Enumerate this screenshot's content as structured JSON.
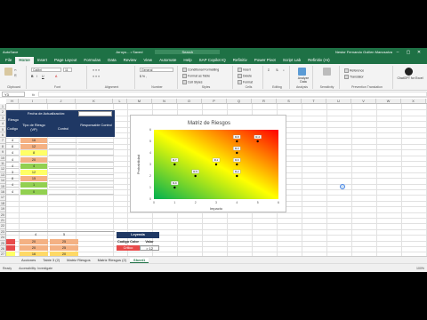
{
  "titlebar": {
    "autosave": "AutoSave",
    "doc": "Arroyo... • Saved",
    "search": "Search",
    "user": "Nestor Fernando Guillen Manosalva"
  },
  "tabs": [
    "File",
    "Home",
    "Insert",
    "Page Layout",
    "Formulas",
    "Data",
    "Review",
    "View",
    "Automate",
    "Help",
    "SAP Copilot IQ",
    "Refinitiv",
    "Power Pivot",
    "Script Lab",
    "Refinitiv (AI)"
  ],
  "ribbon": {
    "font_name": "Calibri",
    "font_size": "11",
    "number_format": "General",
    "groups": [
      "Clipboard",
      "Font",
      "Alignment",
      "Number",
      "Styles",
      "Cells",
      "Editing",
      "Analysis",
      "Sensitivity",
      "Prevention Translation",
      ""
    ],
    "styles": [
      "Conditional Formatting",
      "Format as Table",
      "Cell Styles"
    ],
    "cells": [
      "Insert",
      "Delete",
      "Format"
    ],
    "analyze": "Analyze Data",
    "reference": "Reference",
    "translator": "Translator",
    "gpt": "ChatGPT for Excel"
  },
  "formula_bar": {
    "name_box": "Y3",
    "fx": "fx"
  },
  "columns": [
    "H",
    "I",
    "J",
    "K",
    "L",
    "M",
    "N",
    "O",
    "P",
    "Q",
    "R",
    "S",
    "T",
    "U",
    "V",
    "W",
    "X",
    "Y",
    "Z",
    "AA",
    "AB"
  ],
  "rows": [
    "1",
    "2",
    "3",
    "4",
    "5",
    "6",
    "7",
    "8",
    "9",
    "10",
    "11",
    "12",
    "13",
    "14",
    "15",
    "16",
    "17",
    "18",
    "19",
    "20",
    "21",
    "22",
    "23",
    "24",
    "25",
    "26",
    "27"
  ],
  "sheet": {
    "fecha_label": "Fecha de Actualización:",
    "header": {
      "riesgo": "Riesgo",
      "codigo": "Codigo",
      "tipo": "Tipo de Riesgo (VP)",
      "control": "Control",
      "responsable": "Responsable Control"
    },
    "rows": [
      {
        "code": "4",
        "val": "16",
        "color": "#f4b183"
      },
      {
        "code": "8",
        "val": "12",
        "color": "#f4b183"
      },
      {
        "code": "4",
        "val": "8",
        "color": "#ffff66"
      },
      {
        "code": "4",
        "val": "20",
        "color": "#f4b183"
      },
      {
        "code": "4",
        "val": "4",
        "color": "#92d050"
      },
      {
        "code": "3",
        "val": "12",
        "color": "#ffff66"
      },
      {
        "code": "8",
        "val": "15",
        "color": "#f4b183"
      },
      {
        "code": "4",
        "val": "1",
        "color": "#92d050"
      },
      {
        "code": "4",
        "val": "0",
        "color": "#92d050"
      }
    ],
    "small_header": [
      "4",
      "5"
    ],
    "small_rows": [
      [
        "20",
        "25"
      ],
      [
        "20",
        "25"
      ],
      [
        "16",
        "20"
      ]
    ],
    "legend_title": "Leyenda",
    "legend_header": [
      "Codigo Color",
      "Valor"
    ],
    "legend_row": [
      "Critico",
      "> 12"
    ]
  },
  "chart_data": {
    "type": "scatter",
    "title": "Matriz de Riesgos",
    "xlabel": "Impacto",
    "ylabel": "Probabilidad",
    "xlim": [
      0,
      6
    ],
    "ylim": [
      0,
      6
    ],
    "xticks": [
      "0",
      "1",
      "2",
      "3",
      "4",
      "5",
      "6"
    ],
    "yticks": [
      "0",
      "1",
      "2",
      "3",
      "4",
      "5",
      "6"
    ],
    "points": [
      {
        "x": 1,
        "y": 1,
        "label": "R-9"
      },
      {
        "x": 1,
        "y": 3,
        "label": "R-7"
      },
      {
        "x": 2,
        "y": 2,
        "label": "R-5"
      },
      {
        "x": 3,
        "y": 3,
        "label": "R-1"
      },
      {
        "x": 4,
        "y": 4,
        "label": "R-3"
      },
      {
        "x": 4,
        "y": 3,
        "label": "R-6"
      },
      {
        "x": 4,
        "y": 2,
        "label": "R-2"
      },
      {
        "x": 4,
        "y": 5,
        "label": "R-8"
      },
      {
        "x": 5,
        "y": 5,
        "label": "R-4"
      }
    ]
  },
  "sheet_tabs": [
    "Acciones",
    "Table 3 (2)",
    "Matriz Riesgos",
    "Matriz Riesgos (2)",
    "Sheet1"
  ],
  "active_sheet": "Sheet1",
  "status": {
    "ready": "Ready",
    "access": "Accessibility: Investigate",
    "zoom": "100%"
  }
}
